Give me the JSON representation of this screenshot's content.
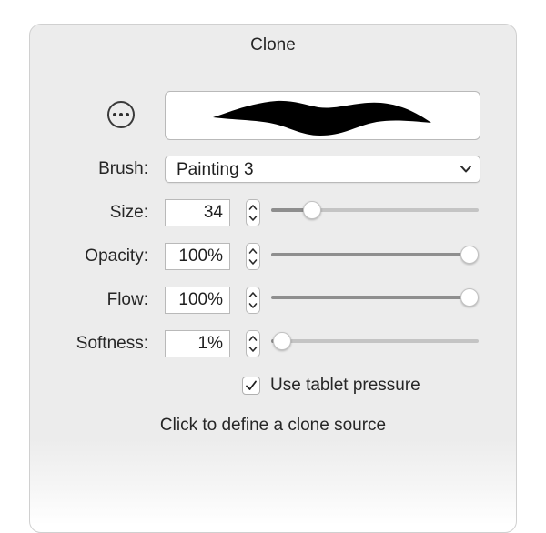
{
  "panel": {
    "title": "Clone",
    "more_icon": "ellipsis-circle-icon",
    "brush": {
      "label": "Brush:",
      "value": "Painting 3",
      "dropdown_icon": "chevron-down-icon"
    },
    "size": {
      "label": "Size:",
      "value": "34",
      "slider_fraction": 0.17
    },
    "opacity": {
      "label": "Opacity:",
      "value": "100%",
      "slider_fraction": 1.0
    },
    "flow": {
      "label": "Flow:",
      "value": "100%",
      "slider_fraction": 1.0
    },
    "softness": {
      "label": "Softness:",
      "value": "1%",
      "slider_fraction": 0.01
    },
    "tablet_pressure": {
      "label": "Use tablet pressure",
      "checked": true
    },
    "hint": "Click to define a clone source"
  },
  "colors": {
    "panel_background": "#ececec",
    "slider_fill": "#8e8e8e",
    "slider_track": "#c4c4c4"
  }
}
